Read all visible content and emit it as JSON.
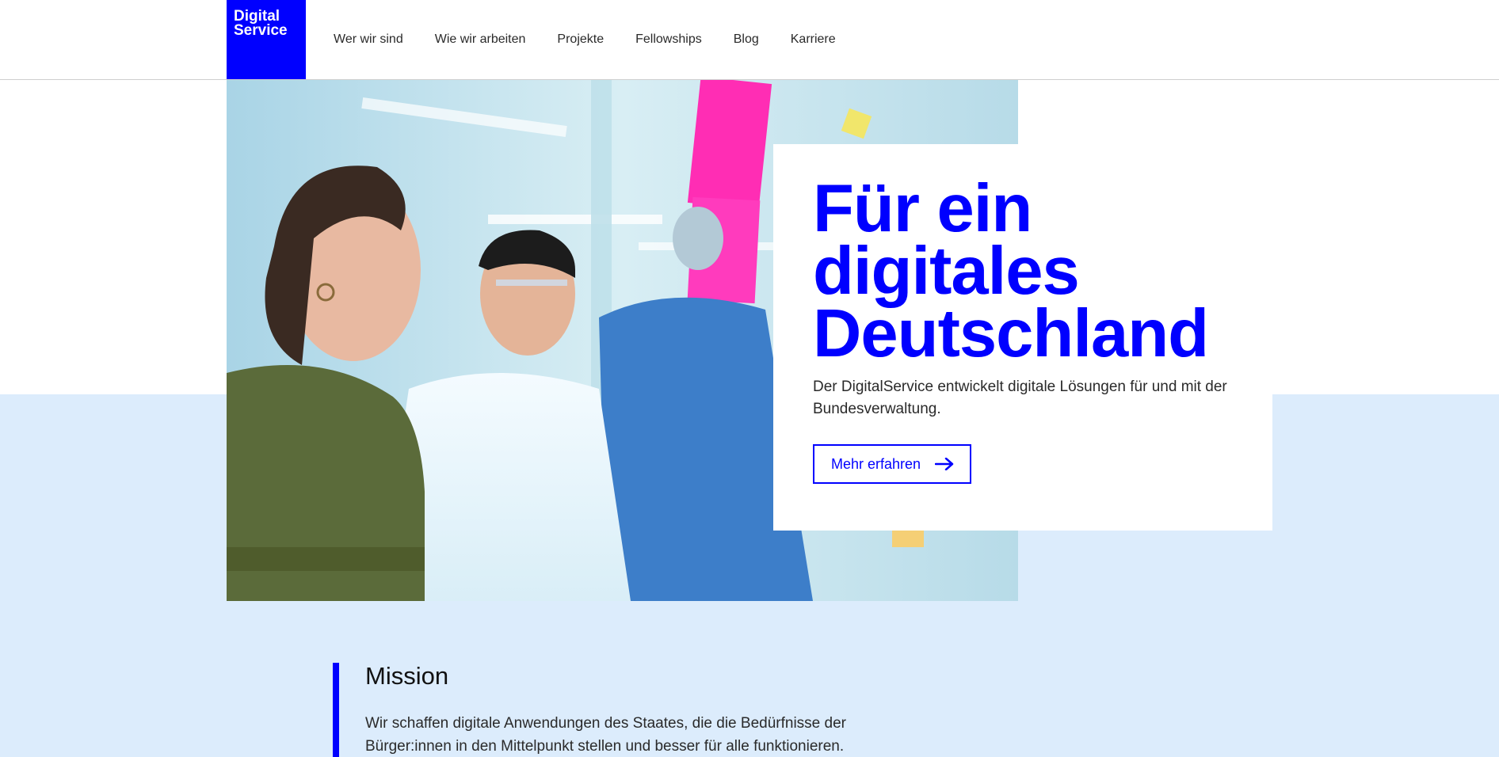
{
  "header": {
    "logo_line1": "Digital",
    "logo_line2": "Service",
    "nav": [
      {
        "label": "Wer wir sind"
      },
      {
        "label": "Wie wir arbeiten"
      },
      {
        "label": "Projekte"
      },
      {
        "label": "Fellowships"
      },
      {
        "label": "Blog"
      },
      {
        "label": "Karriere"
      }
    ]
  },
  "hero": {
    "title_lines": [
      "Für ein",
      "digitales",
      "Deutschland"
    ],
    "text": "Der DigitalService entwickelt digitale Lösungen für und mit der Bundesverwaltung.",
    "cta_label": "Mehr erfahren",
    "cta_icon": "arrow-right-icon",
    "image": "people-at-whiteboard-photo"
  },
  "mission": {
    "title": "Mission",
    "text": "Wir schaffen digitale Anwendungen des Staates, die die Bedürfnisse der Bürger:innen in den Mittelpunkt stellen und besser für alle funktionieren."
  },
  "colors": {
    "brand_blue": "#0000ff",
    "band_background": "#dcecfc",
    "text": "#2a2a2a"
  }
}
